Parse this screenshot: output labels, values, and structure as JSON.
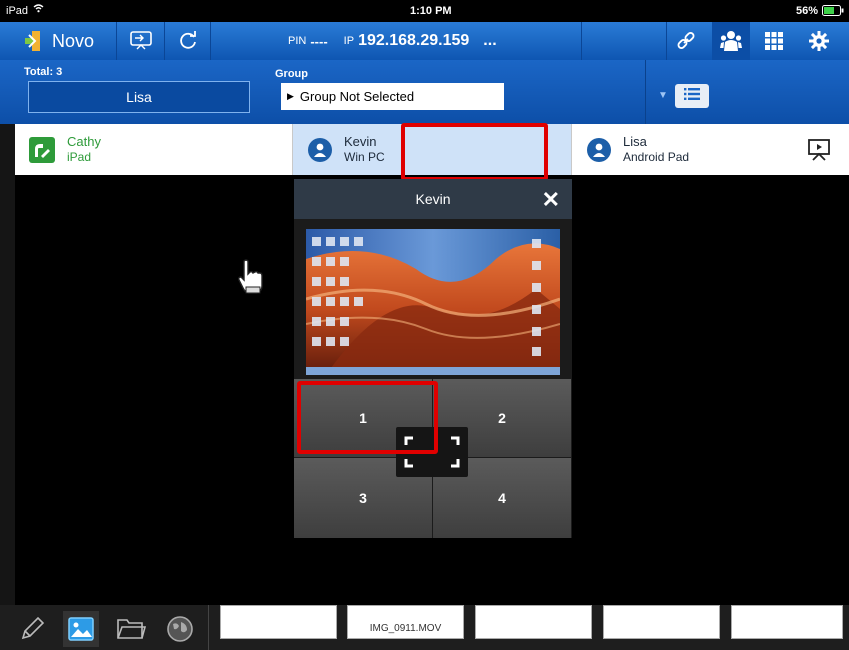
{
  "status_bar": {
    "carrier": "iPad",
    "time": "1:10 PM",
    "battery": "56%"
  },
  "top_nav": {
    "app_name": "Novo",
    "pin_label": "PIN",
    "pin_value": "----",
    "ip_label": "IP",
    "ip_value": "192.168.29.159",
    "more": "...",
    "icons": [
      "novo-logo-icon",
      "screen-share-icon",
      "refresh-icon",
      "link-icon",
      "users-icon",
      "grid-icon",
      "gear-icon"
    ]
  },
  "group_bar": {
    "total_label": "Total: 3",
    "presenter": "Lisa",
    "group_label": "Group",
    "group_value": "Group Not Selected"
  },
  "devices": [
    {
      "name": "Cathy",
      "type": "iPad",
      "color": "#2e9b3a"
    },
    {
      "name": "Kevin",
      "type": "Win PC",
      "color": "#1c5ea8"
    },
    {
      "name": "Lisa",
      "type": "Android Pad",
      "color": "#1c5ea8"
    }
  ],
  "popup": {
    "title": "Kevin",
    "split_positions": [
      "1",
      "2",
      "3",
      "4"
    ]
  },
  "bottom": {
    "thumb_label": "IMG_0911.MOV",
    "icons": [
      "pen-icon",
      "image-icon",
      "folder-icon",
      "globe-icon"
    ]
  },
  "colors": {
    "accent": "#1b66c6",
    "highlight": "#cfe2f8",
    "annotation": "#e00000"
  }
}
